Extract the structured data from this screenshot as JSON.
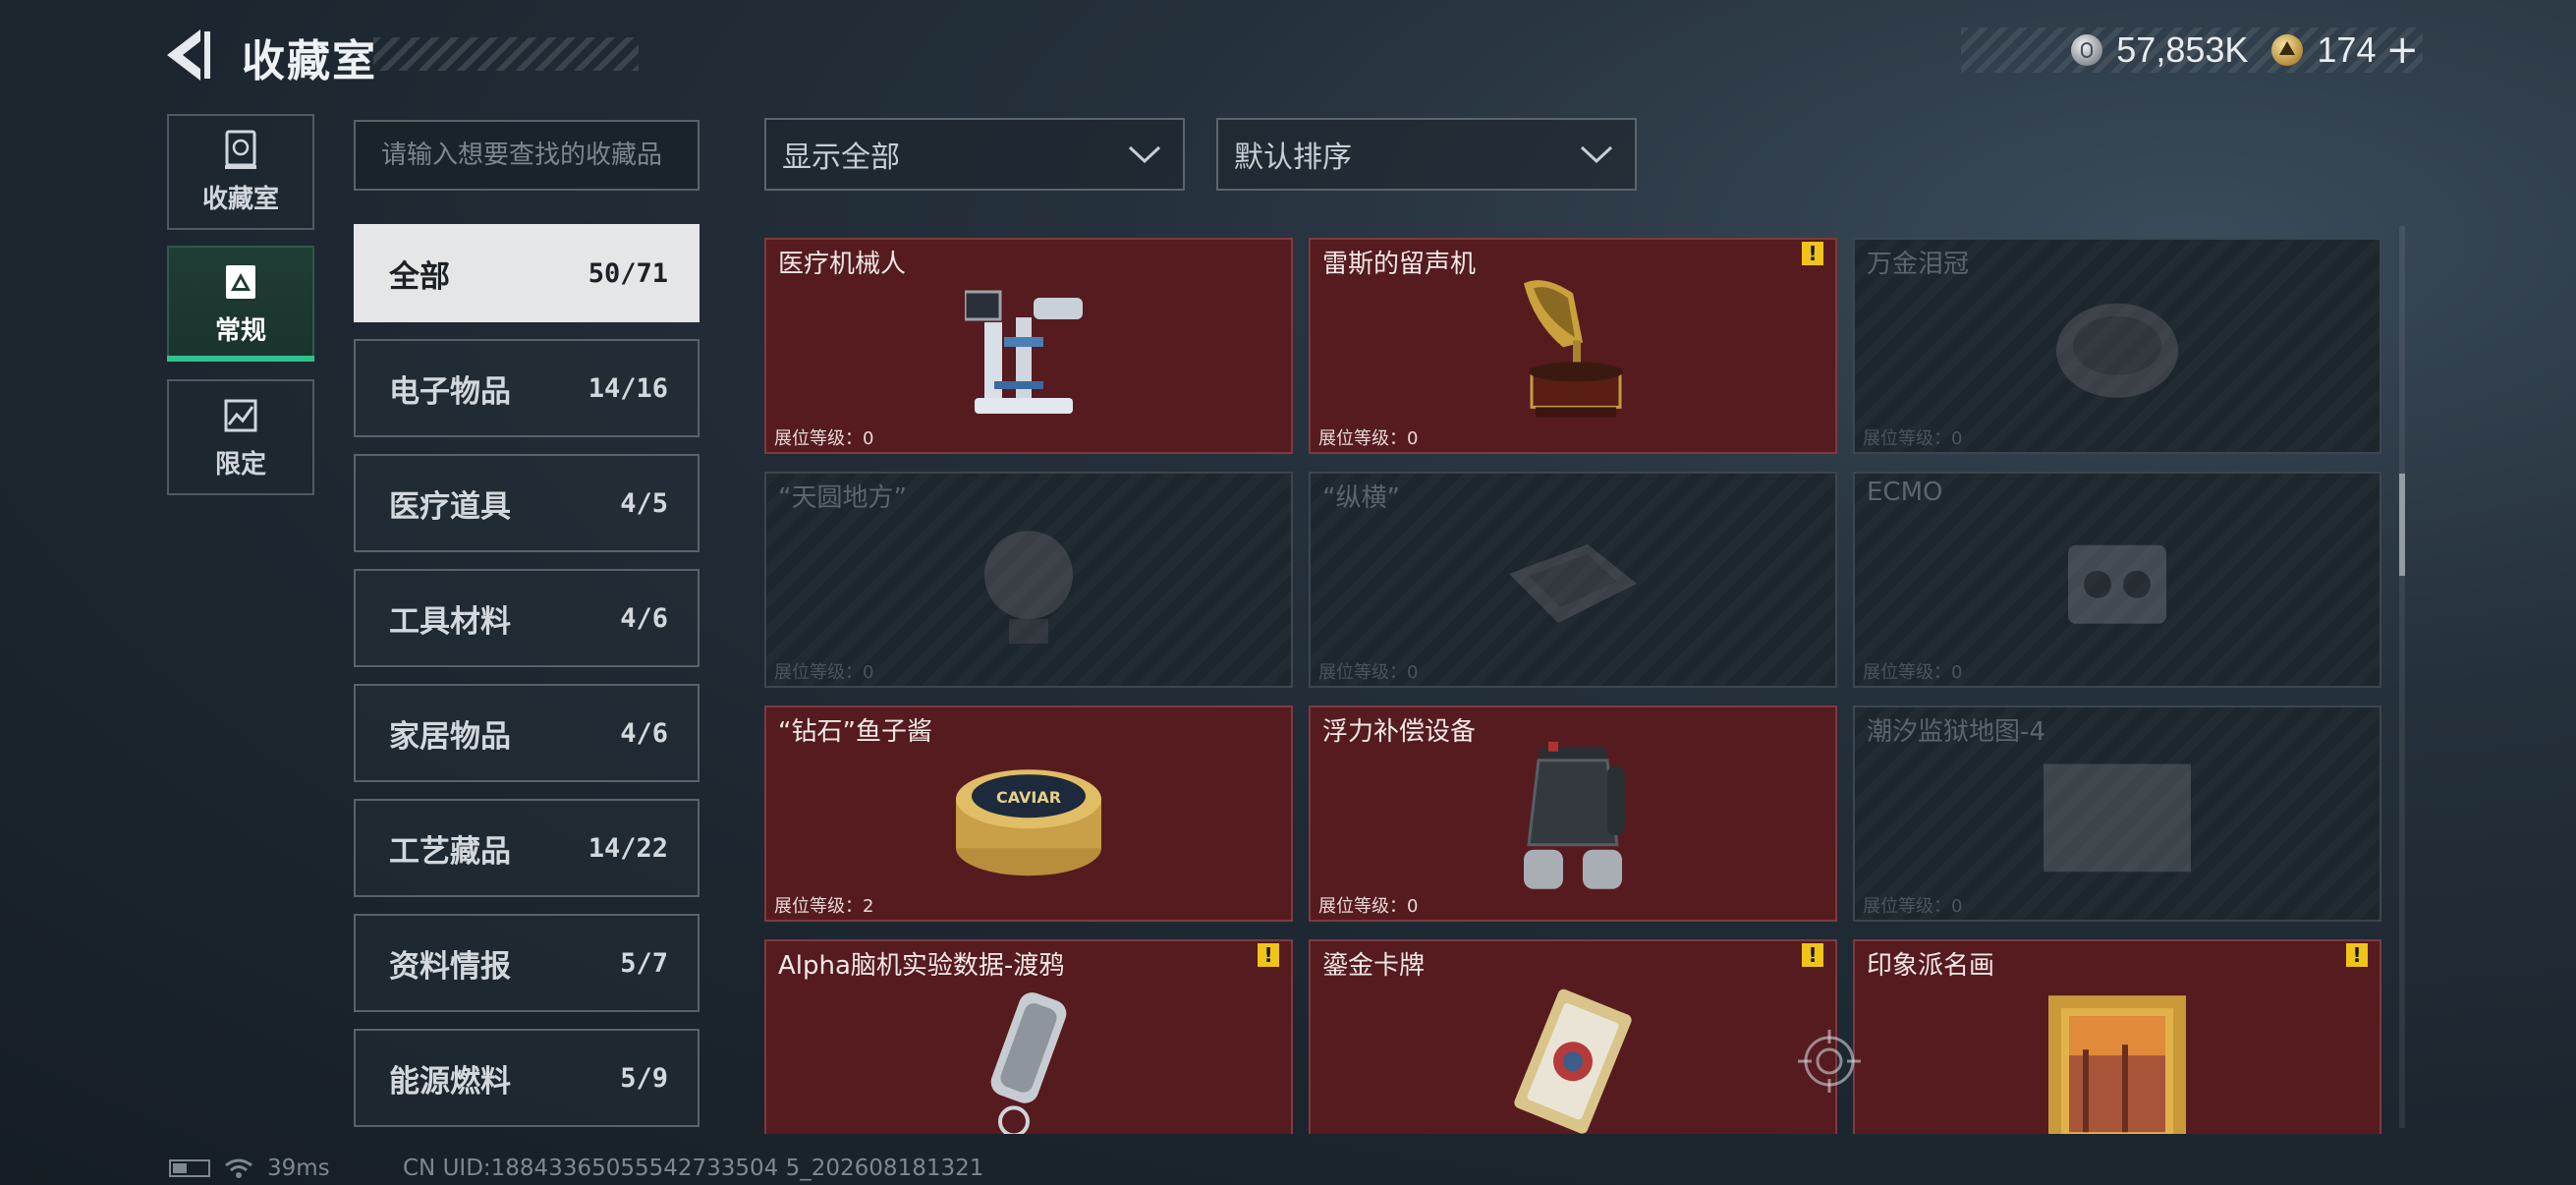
{
  "header": {
    "title": "收藏室",
    "currency_silver": "57,853K",
    "currency_gold": "174",
    "plus": "+"
  },
  "rail": [
    {
      "label": "收藏室",
      "icon": "vault-icon",
      "active": false
    },
    {
      "label": "常规",
      "icon": "display-icon",
      "active": true
    },
    {
      "label": "限定",
      "icon": "map-icon",
      "active": false
    }
  ],
  "search": {
    "placeholder": "请输入想要查找的收藏品"
  },
  "filters": {
    "show": "显示全部",
    "sort": "默认排序"
  },
  "subcategories": [
    {
      "label": "全部",
      "count": "50/71",
      "active": true
    },
    {
      "label": "电子物品",
      "count": "14/16"
    },
    {
      "label": "医疗道具",
      "count": "4/5"
    },
    {
      "label": "工具材料",
      "count": "4/6"
    },
    {
      "label": "家居物品",
      "count": "4/6"
    },
    {
      "label": "工艺藏品",
      "count": "14/22"
    },
    {
      "label": "资料情报",
      "count": "5/7"
    },
    {
      "label": "能源燃料",
      "count": "5/9"
    }
  ],
  "cards": [
    {
      "name": "医疗机械人",
      "level": "展位等级：0",
      "owned": true,
      "warn": false,
      "art": "medical-robot"
    },
    {
      "name": "雷斯的留声机",
      "level": "展位等级：0",
      "owned": true,
      "warn": true,
      "art": "gramophone"
    },
    {
      "name": "万金泪冠",
      "level": "展位等级：0",
      "owned": false,
      "warn": false,
      "art": "crown"
    },
    {
      "name": "“天圆地方”",
      "level": "展位等级：0",
      "owned": false,
      "warn": false,
      "art": "globe"
    },
    {
      "name": "“纵横”",
      "level": "展位等级：0",
      "owned": false,
      "warn": false,
      "art": "chessboard"
    },
    {
      "name": "ECMO",
      "level": "展位等级：0",
      "owned": false,
      "warn": false,
      "art": "ecmo"
    },
    {
      "name": "“钻石”鱼子酱",
      "level": "展位等级：2",
      "owned": true,
      "warn": false,
      "art": "caviar"
    },
    {
      "name": "浮力补偿设备",
      "level": "展位等级：0",
      "owned": true,
      "warn": false,
      "art": "bcd"
    },
    {
      "name": "潮汐监狱地图-4",
      "level": "展位等级：0",
      "owned": false,
      "warn": false,
      "art": "map"
    },
    {
      "name": "Alpha脑机实验数据-渡鸦",
      "level": "",
      "owned": true,
      "warn": true,
      "art": "datastick"
    },
    {
      "name": "鎏金卡牌",
      "level": "",
      "owned": true,
      "warn": true,
      "art": "card"
    },
    {
      "name": "印象派名画",
      "level": "",
      "owned": true,
      "warn": true,
      "art": "painting"
    }
  ],
  "caviar_label": "CAVIAR",
  "footer": {
    "ping": "39ms",
    "uid": "CN UID:18843365055542733504 5_202608181321"
  },
  "colors": {
    "accent": "#2fc28a",
    "owned_card": "#551b1f",
    "warn": "#f0c419"
  }
}
